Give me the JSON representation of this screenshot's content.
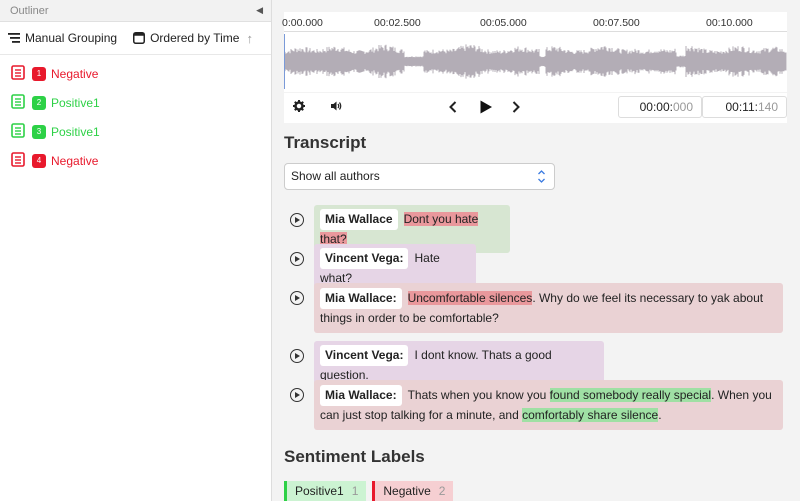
{
  "outliner": {
    "title": "Outliner",
    "manual_grouping": "Manual Grouping",
    "ordered_by_time": "Ordered by Time",
    "items": [
      {
        "num": "1",
        "label": "Negative",
        "kind": "neg"
      },
      {
        "num": "2",
        "label": "Positive1",
        "kind": "pos"
      },
      {
        "num": "3",
        "label": "Positive1",
        "kind": "pos"
      },
      {
        "num": "4",
        "label": "Negative",
        "kind": "neg"
      }
    ]
  },
  "timeline": {
    "ticks": [
      "0:00.000",
      "00:02.500",
      "00:05.000",
      "00:07.500",
      "00:10.000"
    ],
    "current_time": "00:00:",
    "current_ms": "000",
    "total_time": "00:11:",
    "total_ms": "140"
  },
  "transcript": {
    "title": "Transcript",
    "filter_value": "Show all authors",
    "messages": [
      {
        "author": "Mia Wallace",
        "parts": [
          {
            "t": "Dont you hate that?",
            "h": "red"
          }
        ],
        "bg": "green"
      },
      {
        "author": "Vincent Vega:",
        "parts": [
          {
            "t": "Hate what?",
            "h": ""
          }
        ],
        "bg": "purple"
      },
      {
        "author": "Mia Wallace:",
        "parts": [
          {
            "t": "Uncomfortable silences",
            "h": "red"
          },
          {
            "t": ". Why do we feel its necessary to yak about things in order to be comfortable?",
            "h": ""
          }
        ],
        "bg": "red"
      },
      {
        "author": "Vincent Vega:",
        "parts": [
          {
            "t": "I dont know. Thats a good question.",
            "h": ""
          }
        ],
        "bg": "purple"
      },
      {
        "author": "Mia Wallace:",
        "parts": [
          {
            "t": "Thats when you know you ",
            "h": ""
          },
          {
            "t": "found somebody really special",
            "h": "green"
          },
          {
            "t": ". When you can just stop talking for a minute, and ",
            "h": ""
          },
          {
            "t": "comfortably share silence",
            "h": "green"
          },
          {
            "t": ".",
            "h": ""
          }
        ],
        "bg": "red"
      }
    ]
  },
  "sentiment": {
    "title": "Sentiment Labels",
    "labels": [
      {
        "name": "Positive1",
        "count": "1",
        "kind": "pos"
      },
      {
        "name": "Negative",
        "count": "2",
        "kind": "neg"
      }
    ]
  }
}
